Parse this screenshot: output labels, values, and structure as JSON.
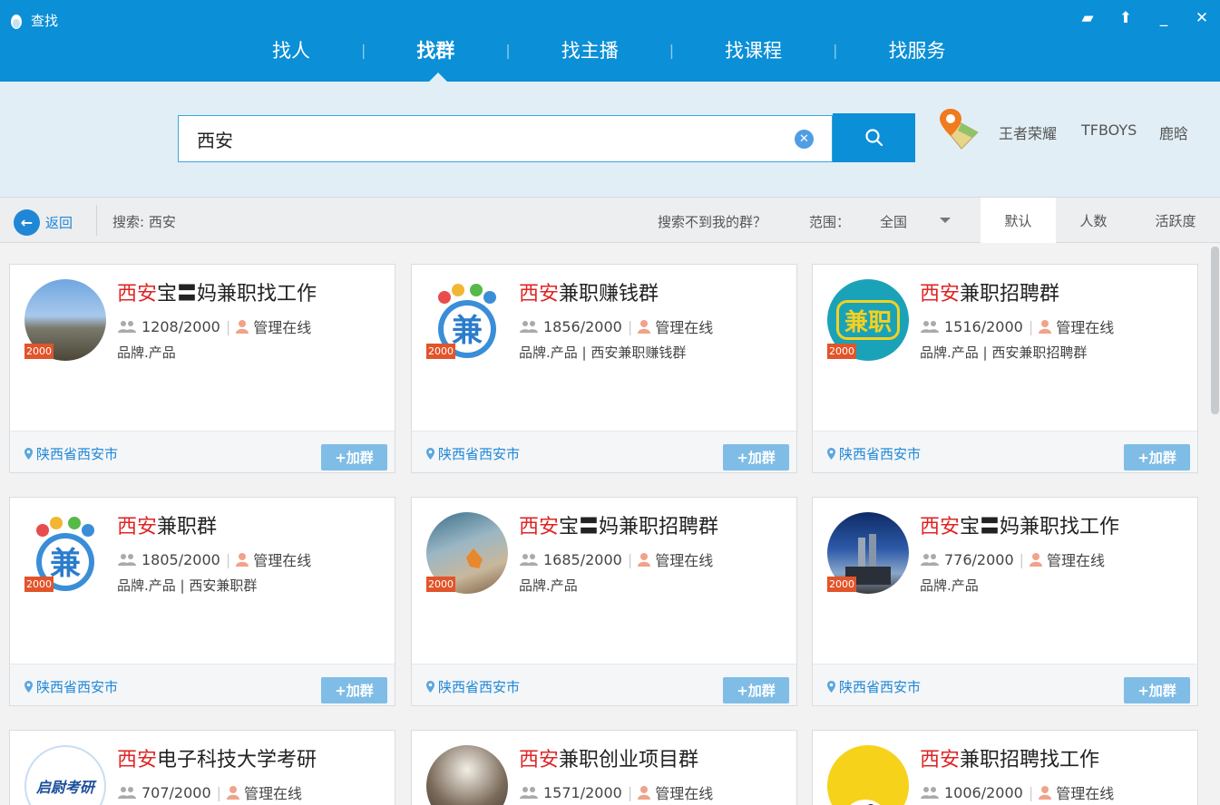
{
  "app": {
    "title": "查找"
  },
  "tabs": [
    {
      "label": "找人"
    },
    {
      "label": "找群"
    },
    {
      "label": "找主播"
    },
    {
      "label": "找课程"
    },
    {
      "label": "找服务"
    }
  ],
  "search": {
    "value": "西安"
  },
  "hot": [
    "王者荣耀",
    "TFBOYS",
    "鹿晗"
  ],
  "toolbar": {
    "back_label": "返回",
    "search_prefix": "搜索: 西安",
    "not_found": "搜索不到我的群？",
    "range_label": "范围：",
    "range_value": "全国",
    "sort": [
      "默认",
      "人数",
      "活跃度"
    ]
  },
  "cards": [
    {
      "prefix": "西安",
      "suffix": "宝〓妈兼职找工作",
      "count": "1208/2000",
      "admin": "管理在线",
      "tags": "品牌.产品",
      "location": "陕西省西安市",
      "badge": "2000",
      "join": "+加群"
    },
    {
      "prefix": "西安",
      "suffix": "兼职赚钱群",
      "count": "1856/2000",
      "admin": "管理在线",
      "tags": "品牌.产品 | 西安兼职赚钱群",
      "location": "陕西省西安市",
      "badge": "2000",
      "join": "+加群"
    },
    {
      "prefix": "西安",
      "suffix": "兼职招聘群",
      "count": "1516/2000",
      "admin": "管理在线",
      "tags": "品牌.产品 | 西安兼职招聘群",
      "location": "陕西省西安市",
      "badge": "2000",
      "join": "+加群",
      "avatar_text": "兼职"
    },
    {
      "prefix": "西安",
      "suffix": "兼职群",
      "count": "1805/2000",
      "admin": "管理在线",
      "tags": "品牌.产品 | 西安兼职群",
      "location": "陕西省西安市",
      "badge": "2000",
      "join": "+加群"
    },
    {
      "prefix": "西安",
      "suffix": "宝〓妈兼职招聘群",
      "count": "1685/2000",
      "admin": "管理在线",
      "tags": "品牌.产品",
      "location": "陕西省西安市",
      "badge": "2000",
      "join": "+加群"
    },
    {
      "prefix": "西安",
      "suffix": "宝〓妈兼职找工作",
      "count": "776/2000",
      "admin": "管理在线",
      "tags": "品牌.产品",
      "location": "陕西省西安市",
      "badge": "2000",
      "join": "+加群"
    },
    {
      "prefix": "西安",
      "suffix": "电子科技大学考研",
      "count": "707/2000",
      "admin": "管理在线",
      "tags": "",
      "location": "",
      "badge": "",
      "join": "",
      "avatar_text": "启尉考研"
    },
    {
      "prefix": "西安",
      "suffix": "兼职创业项目群",
      "count": "1571/2000",
      "admin": "管理在线",
      "tags": "",
      "location": "",
      "badge": "",
      "join": ""
    },
    {
      "prefix": "西安",
      "suffix": "兼职招聘找工作",
      "count": "1006/2000",
      "admin": "管理在线",
      "tags": "",
      "location": "",
      "badge": "",
      "join": ""
    }
  ],
  "colors": {
    "brand": "#0b8fd6",
    "highlight": "#e02424",
    "link": "#1f87d6",
    "join": "#7fbde6",
    "badge": "#e2542a"
  }
}
